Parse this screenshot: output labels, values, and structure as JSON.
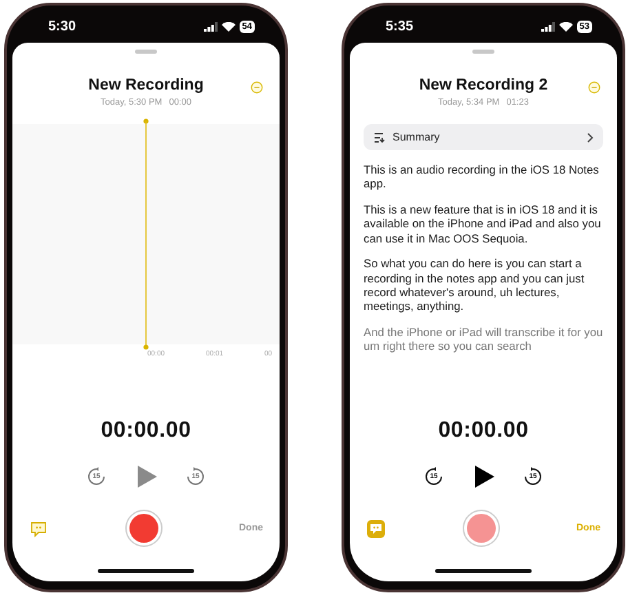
{
  "phones": [
    {
      "kind": "waveform",
      "status": {
        "time": "5:30",
        "battery": "54"
      },
      "title": "New Recording",
      "date": "Today, 5:30 PM",
      "duration": "00:00",
      "ticks": [
        "00:00",
        "00:01",
        "00"
      ],
      "timer": "00:00.00",
      "skip_back": "15",
      "skip_forward": "15",
      "play_enabled": false,
      "transcript_on": false,
      "record_dimmed": false,
      "done_label": "Done",
      "done_enabled": false
    },
    {
      "kind": "transcript",
      "status": {
        "time": "5:35",
        "battery": "53"
      },
      "title": "New Recording 2",
      "date": "Today, 5:34 PM",
      "duration": "01:23",
      "summary": "Summary",
      "paragraphs": [
        "This is an audio recording in the iOS 18 Notes app.",
        "This is a new feature that is in iOS 18 and it is available on the iPhone and iPad and also you can use it in Mac OOS Sequoia.",
        "So what you can do here is you can start a recording in the notes app and you can just record whatever's around, uh lectures, meetings, anything.",
        "And the iPhone or iPad will transcribe it for you um right there so you can search"
      ],
      "timer": "00:00.00",
      "skip_back": "15",
      "skip_forward": "15",
      "play_enabled": true,
      "transcript_on": true,
      "record_dimmed": true,
      "done_label": "Done",
      "done_enabled": true
    }
  ]
}
